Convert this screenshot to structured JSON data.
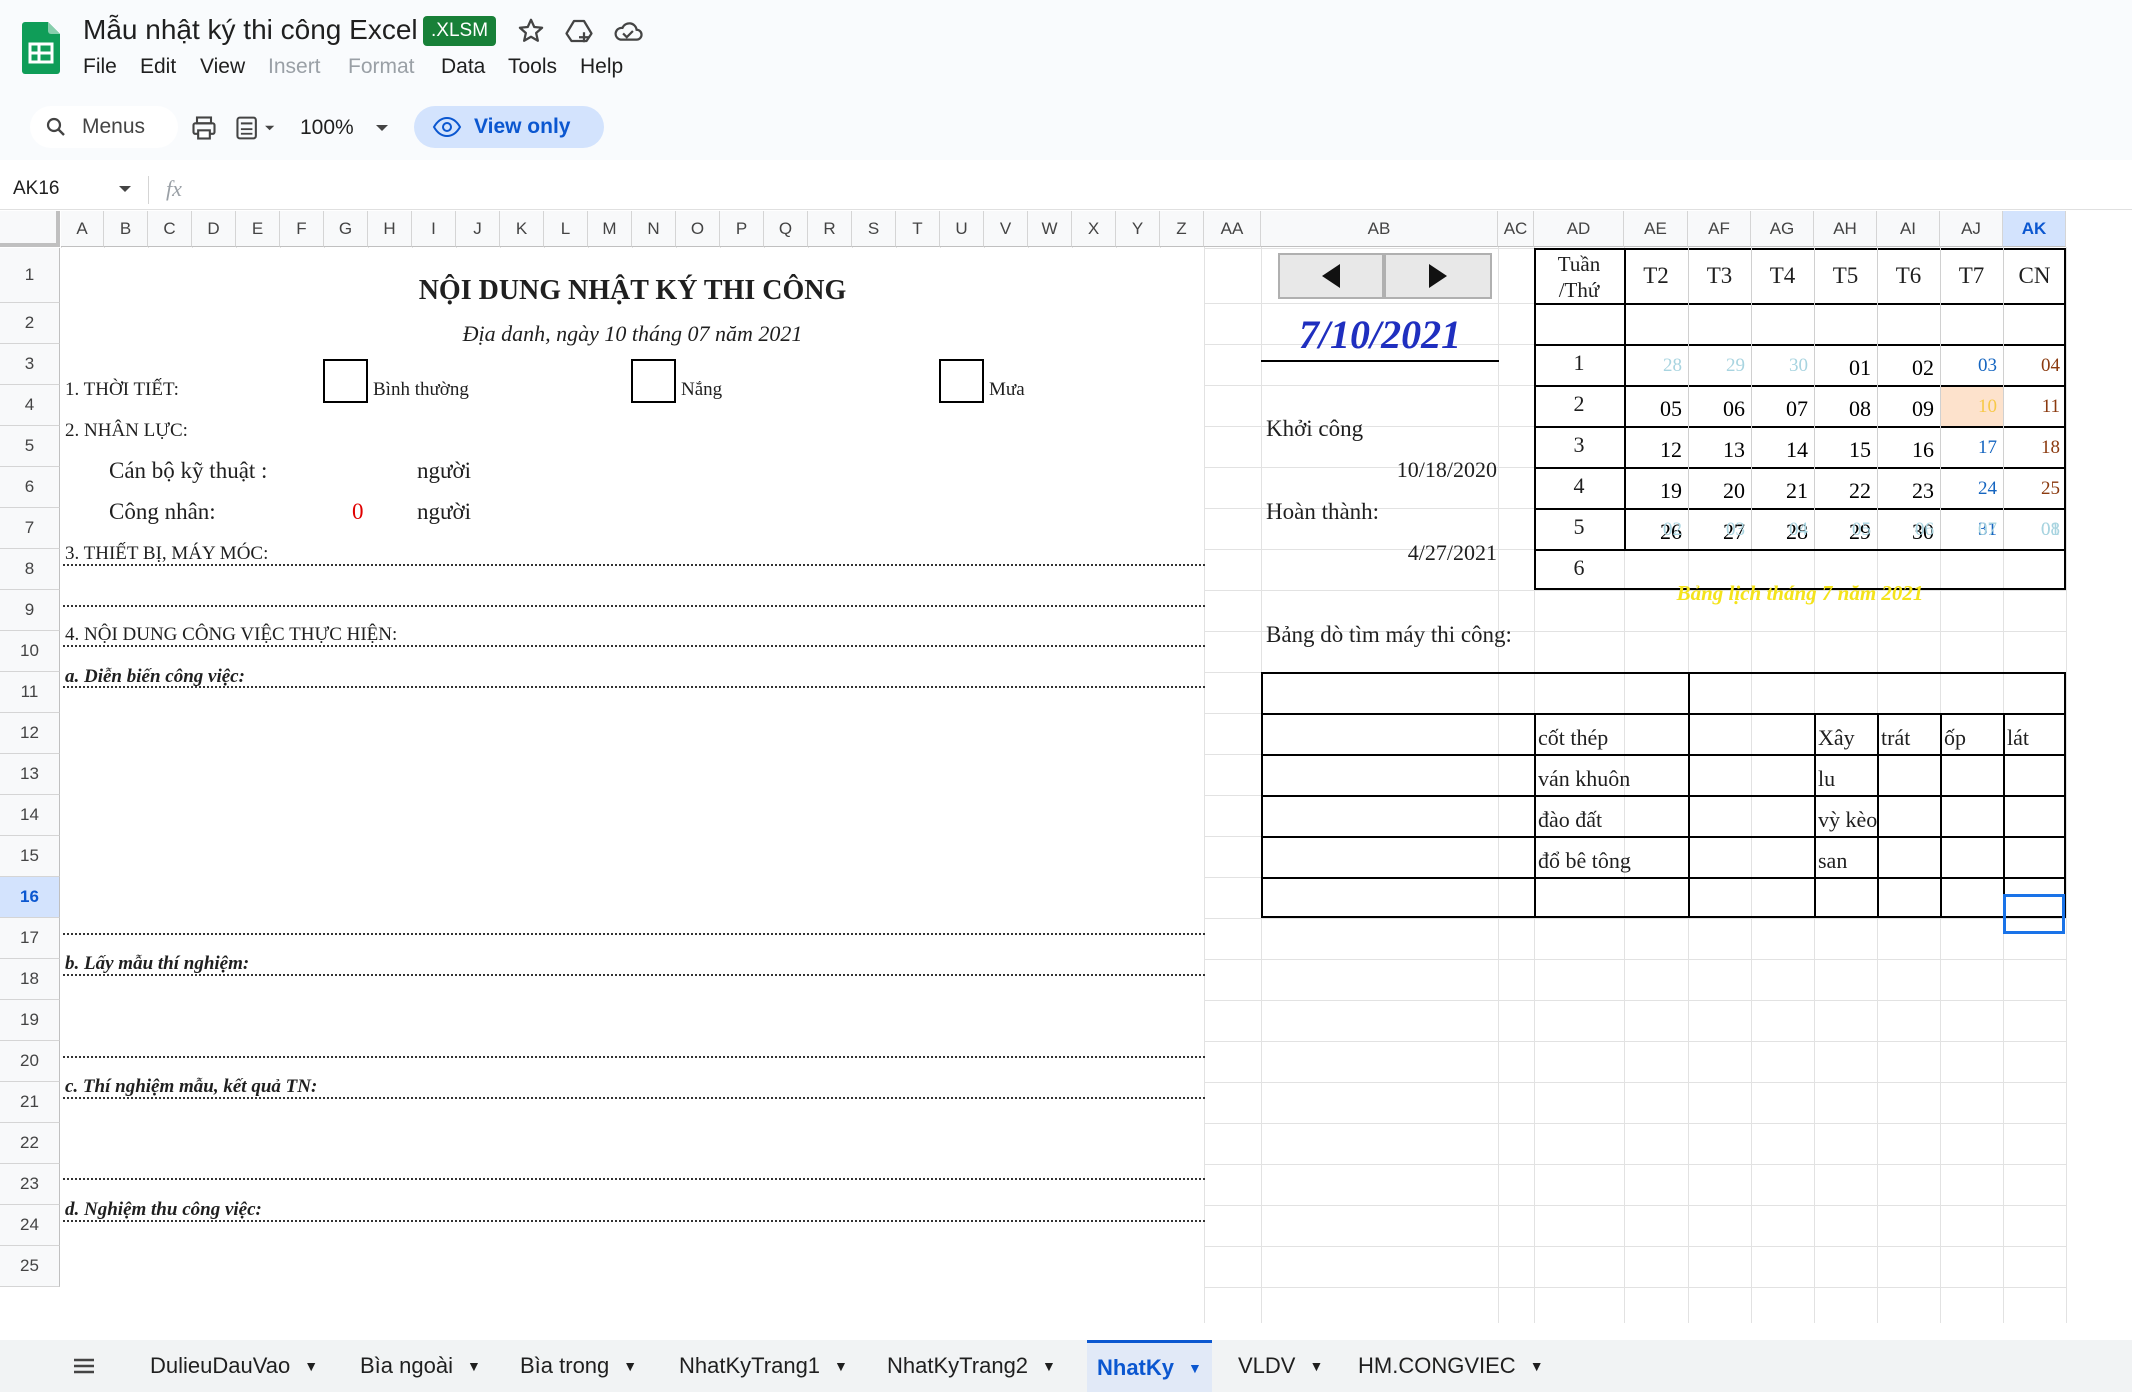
{
  "app": {
    "title": "Mẫu nhật ký thi công Excel",
    "badge": ".XLSM",
    "menu": [
      "File",
      "Edit",
      "View",
      "Insert",
      "Format",
      "Data",
      "Tools",
      "Help"
    ],
    "menu_disabled": [
      "Insert",
      "Format"
    ]
  },
  "toolbar": {
    "search_label": "Menus",
    "zoom": "100%",
    "view_only_label": "View only"
  },
  "formula_bar": {
    "name_box": "AK16",
    "fx": "fx"
  },
  "columns": [
    "A",
    "B",
    "C",
    "D",
    "E",
    "F",
    "G",
    "H",
    "I",
    "J",
    "K",
    "L",
    "M",
    "N",
    "O",
    "P",
    "Q",
    "R",
    "S",
    "T",
    "U",
    "V",
    "W",
    "X",
    "Y",
    "Z",
    "AA",
    "AB",
    "AC",
    "AD",
    "AE",
    "AF",
    "AG",
    "AH",
    "AI",
    "AJ",
    "AK"
  ],
  "selected_column": "AK",
  "rows": [
    "1",
    "2",
    "3",
    "4",
    "5",
    "6",
    "7",
    "8",
    "9",
    "10",
    "11",
    "12",
    "13",
    "14",
    "15",
    "16",
    "17",
    "18",
    "19",
    "20",
    "21",
    "22",
    "23",
    "24",
    "25"
  ],
  "selected_row": "16",
  "sheet": {
    "title": "NỘI DUNG NHẬT KÝ THI CÔNG",
    "subtitle": "Địa danh, ngày 10 tháng 07 năm 2021",
    "weather_label": "1. THỜI TIẾT:",
    "weather_options": [
      "Bình thường",
      "Nắng",
      "Mưa"
    ],
    "manpower_label": "2. NHÂN LỰC:",
    "tech_staff_label": "Cán bộ kỹ thuật  :",
    "tech_staff_unit": "người",
    "workers_label": "Công nhân:",
    "workers_count": "0",
    "workers_unit": "người",
    "equipment_label": "3. THIẾT BỊ, MÁY MÓC:",
    "work_label": "4. NỘI DUNG CÔNG VIỆC THỰC HIỆN:",
    "work_a": "a. Diễn biến công việc:",
    "work_b": "b. Lấy mẫu thí nghiệm:",
    "work_c": "c. Thí nghiệm mẫu, kết quả TN:",
    "work_d": "d. Nghiệm thu công việc:"
  },
  "side": {
    "date": "7/10/2021",
    "start_label": "Khởi công",
    "start_date": "10/18/2020",
    "finish_label": "Hoàn thành:",
    "finish_date": "4/27/2021",
    "machine_lookup_label": "Bảng dò tìm máy thi công:",
    "work_types_left": [
      "cốt thép",
      "ván khuôn",
      "đào đất",
      "đổ bê tông"
    ],
    "work_types_right": [
      "Xây",
      "lu",
      "vỳ kèo",
      "san"
    ],
    "extra_headers": [
      "trát",
      "ốp",
      "lát"
    ]
  },
  "calendar": {
    "header_week": "Tuần\n/Thứ",
    "days": [
      "T2",
      "T3",
      "T4",
      "T5",
      "T6",
      "T7",
      "CN"
    ],
    "weeks": [
      {
        "n": "1",
        "d": [
          "28",
          "29",
          "30",
          "01",
          "02",
          "03",
          "04"
        ]
      },
      {
        "n": "2",
        "d": [
          "05",
          "06",
          "07",
          "08",
          "09",
          "10",
          "11"
        ]
      },
      {
        "n": "3",
        "d": [
          "12",
          "13",
          "14",
          "15",
          "16",
          "17",
          "18"
        ]
      },
      {
        "n": "4",
        "d": [
          "19",
          "20",
          "21",
          "22",
          "23",
          "24",
          "25"
        ]
      },
      {
        "n": "5",
        "d": [
          "26",
          "27",
          "28",
          "29",
          "30",
          "31",
          "01"
        ]
      },
      {
        "n": "6",
        "d": [
          "02",
          "03",
          "04",
          "05",
          "06",
          "07",
          "08"
        ]
      }
    ],
    "caption": "Bảng lịch tháng 7 năm 2021",
    "colors": {
      "other_month": "#a8d4e0",
      "saturday": "#1565c0",
      "sunday": "#8b3a0f",
      "today_bg": "#fde2cc",
      "today_fg": "#f7c948",
      "caption": "#f4e31a",
      "date": "#1f2fbf"
    }
  },
  "tabs": [
    "DulieuDauVao",
    "Bìa ngoài",
    "Bìa trong",
    "NhatKyTrang1",
    "NhatKyTrang2",
    "NhatKy",
    "VLDV",
    "HM.CONGVIEC"
  ],
  "active_tab": "NhatKy"
}
